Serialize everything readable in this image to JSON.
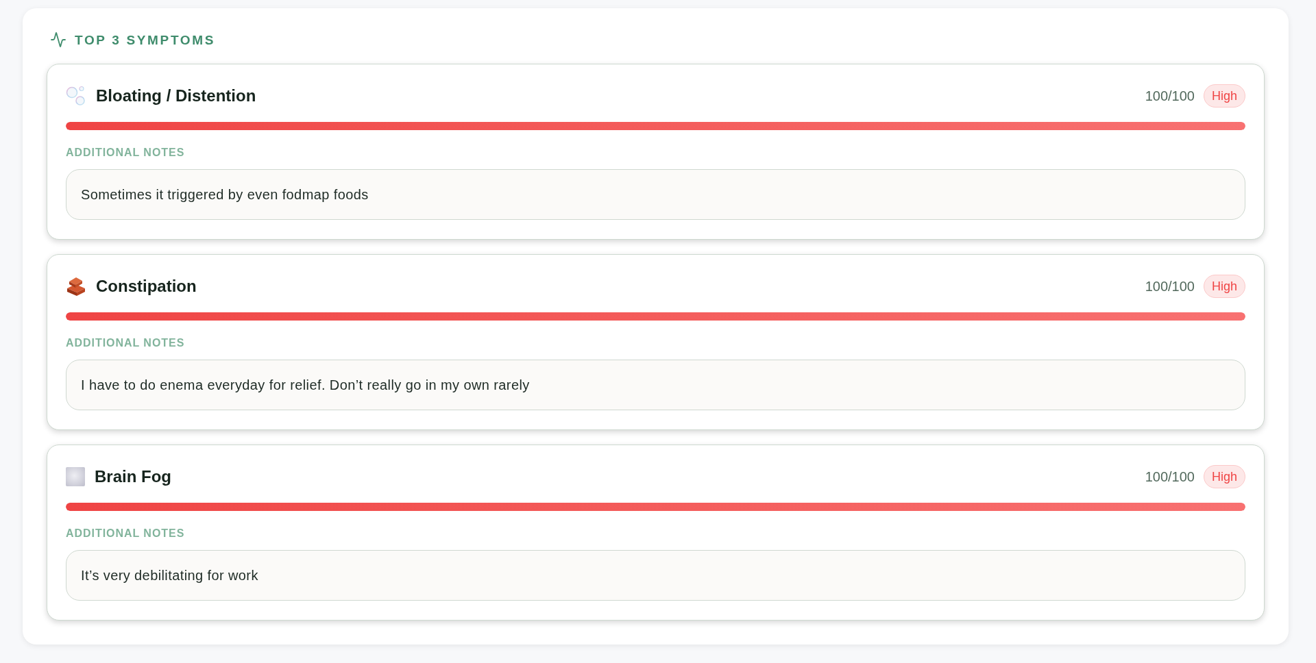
{
  "section": {
    "title": "TOP 3 SYMPTOMS"
  },
  "symptoms": [
    {
      "name": "Bloating / Distention",
      "score": "100/100",
      "severity": "High",
      "level": 1,
      "notes_label": "ADDITIONAL NOTES",
      "notes": "Sometimes it triggered by even fodmap foods"
    },
    {
      "name": "Constipation",
      "score": "100/100",
      "severity": "High",
      "level": 1,
      "notes_label": "ADDITIONAL NOTES",
      "notes": "I have to do enema everyday for relief. Don’t really go in my own rarely"
    },
    {
      "name": "Brain Fog",
      "score": "100/100",
      "severity": "High",
      "level": 1,
      "notes_label": "ADDITIONAL NOTES",
      "notes": "It’s very debilitating for work"
    }
  ]
}
